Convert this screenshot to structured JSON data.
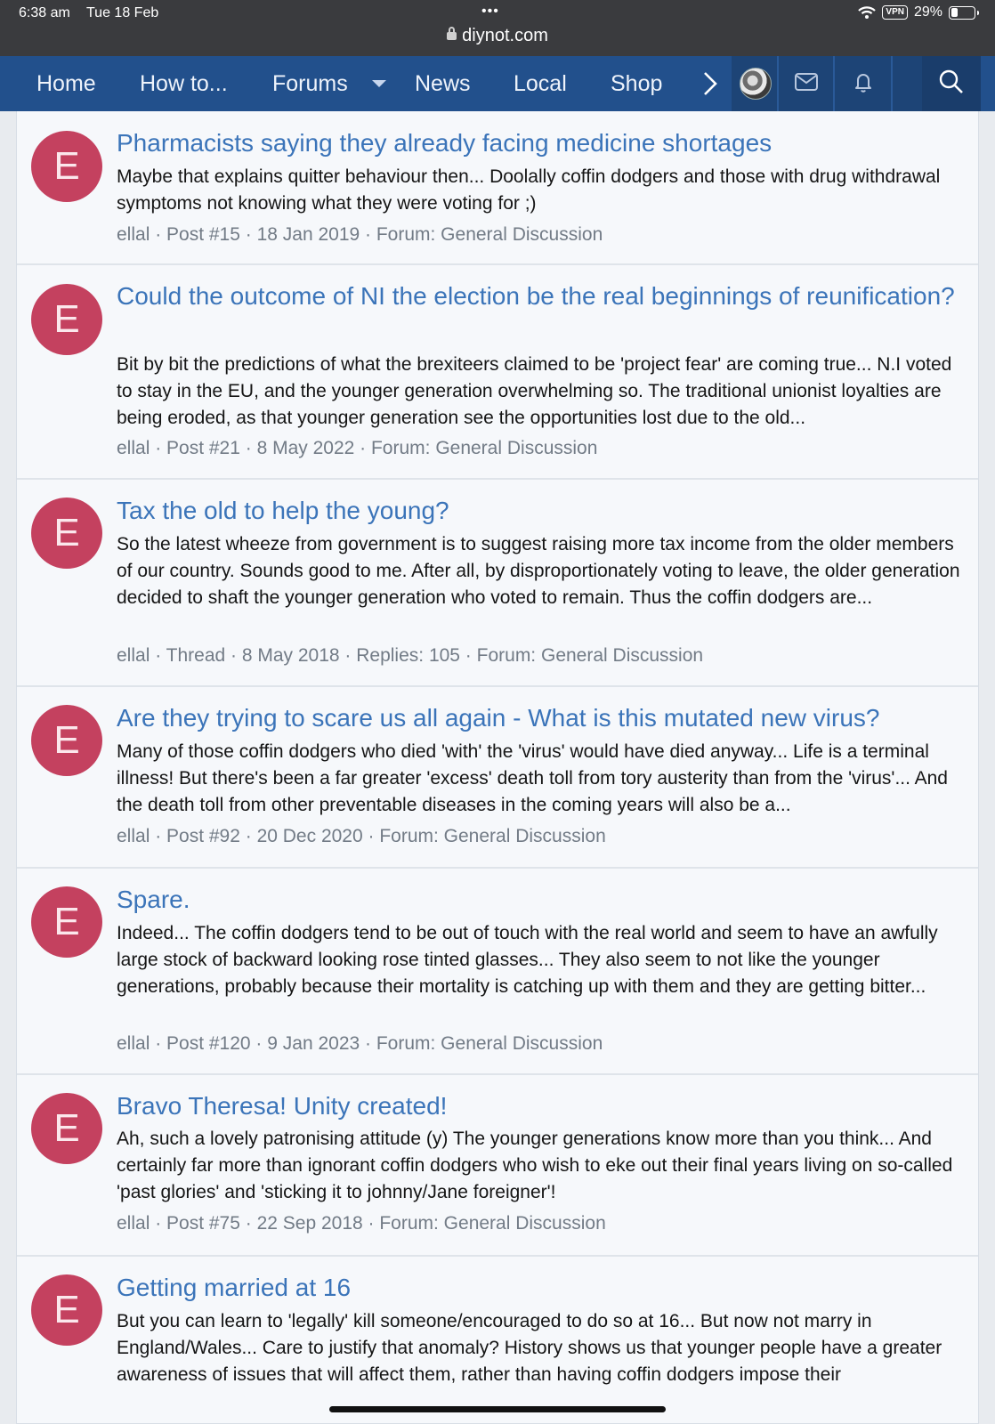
{
  "status_bar": {
    "time": "6:38 am",
    "date": "Tue 18 Feb",
    "dots": "•••",
    "url": "diynot.com",
    "vpn": "VPN",
    "battery": "29%",
    "battery_level": 0.29
  },
  "nav": {
    "items": [
      "Home",
      "How to...",
      "Forums",
      "News",
      "Local",
      "Shop"
    ],
    "icons": [
      "chevron-right-icon",
      "avatar",
      "mail-icon",
      "bell-icon",
      "search-icon"
    ]
  },
  "results": [
    {
      "avatar_letter": "E",
      "title": "Pharmacists saying they already facing medicine shortages",
      "snippet": "Maybe that explains quitter behaviour then... Doolally coffin dodgers and those with drug withdrawal symptoms not knowing what they were voting for ;)",
      "meta": "ellal · Post #15 · 18 Jan 2019 · Forum: General Discussion"
    },
    {
      "avatar_letter": "E",
      "title": "Could the outcome of NI the election be the real beginnings of reunification?",
      "snippet": "Bit by bit the predictions of what the brexiteers claimed to be 'project fear' are coming true... N.I voted to stay in the EU, and the younger generation overwhelming so. The traditional unionist loyalties are being eroded, as that younger generation see the opportunities lost due to the old...",
      "meta": "ellal · Post #21 · 8 May 2022 · Forum: General Discussion"
    },
    {
      "avatar_letter": "E",
      "title": "Tax the old to help the young?",
      "snippet": "So the latest wheeze from government is to suggest raising more tax income from the older members of our country. Sounds good to me. After all, by disproportionately voting to leave, the older generation decided to shaft the younger generation who voted to remain. Thus the coffin dodgers are...",
      "meta": "ellal · Thread · 8 May 2018 · Replies: 105 · Forum: General Discussion"
    },
    {
      "avatar_letter": "E",
      "title": "Are they trying to scare us all again - What is this mutated new virus?",
      "snippet": "Many of those coffin dodgers who died 'with' the 'virus' would have died anyway... Life is a terminal illness! But there's been a far greater 'excess' death toll from tory austerity than from the 'virus'... And the death toll from other preventable diseases in the coming years will also be a...",
      "meta": "ellal · Post #92 · 20 Dec 2020 · Forum: General Discussion"
    },
    {
      "avatar_letter": "E",
      "title": "Spare.",
      "snippet": "Indeed... The coffin dodgers tend to be out of touch with the real world and seem to have an awfully large stock of backward looking rose tinted glasses... They also seem to not like the younger generations, probably because their mortality is catching up with them and they are getting bitter...",
      "meta": "ellal · Post #120 · 9 Jan 2023 · Forum: General Discussion"
    },
    {
      "avatar_letter": "E",
      "title": "Bravo Theresa! Unity created!",
      "snippet": "Ah, such a lovely patronising attitude (y) The younger generations know more than you think... And certainly far more than ignorant coffin dodgers who wish to eke out their final years living on so-called 'past glories' and 'sticking it to johnny/Jane foreigner'!",
      "meta": "ellal · Post #75 · 22 Sep 2018 · Forum: General Discussion"
    },
    {
      "avatar_letter": "E",
      "title": "Getting married at 16",
      "snippet": "But you can learn to 'legally' kill someone/encouraged to do so at 16... But now not marry in England/Wales... Care to justify that anomaly? History shows us that younger people have a greater awareness of issues that will affect them, rather than having coffin dodgers impose their",
      "meta": ""
    }
  ]
}
